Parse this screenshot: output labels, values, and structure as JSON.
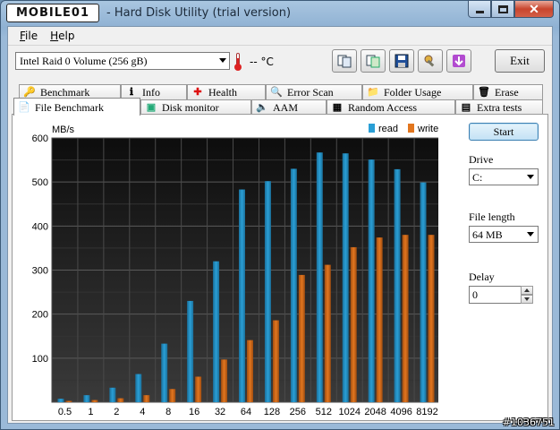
{
  "window": {
    "logo_text": "MOBILE01",
    "title": "- Hard Disk Utility (trial version)"
  },
  "menu": [
    {
      "label": "File",
      "underline": "F",
      "rest": "ile"
    },
    {
      "label": "Help",
      "underline": "H",
      "rest": "elp"
    }
  ],
  "toolbar": {
    "drive": "Intel   Raid 0 Volume (256 gB)",
    "temperature": "-- °C",
    "exit_label": "Exit"
  },
  "tabs_top": [
    "Benchmark",
    "Info",
    "Health",
    "Error Scan",
    "Folder Usage",
    "Erase"
  ],
  "tabs_bottom": [
    "File Benchmark",
    "Disk monitor",
    "AAM",
    "Random Access",
    "Extra tests"
  ],
  "active_tab": "File Benchmark",
  "controls": {
    "start_label": "Start",
    "drive_label": "Drive",
    "drive_value": "C:",
    "file_length_label": "File length",
    "file_length_value": "64 MB",
    "delay_label": "Delay",
    "delay_value": "0"
  },
  "colors": {
    "read": "#2a9fd6",
    "write": "#e2761f",
    "plot_bg": "#1a1a1a"
  },
  "chart_data": {
    "type": "bar",
    "ylabel": "MB/s",
    "xlabel": "",
    "ylim": [
      0,
      600
    ],
    "yticks": [
      100,
      200,
      300,
      400,
      500,
      600
    ],
    "categories": [
      "0.5",
      "1",
      "2",
      "4",
      "8",
      "16",
      "32",
      "64",
      "128",
      "256",
      "512",
      "1024",
      "2048",
      "4096",
      "8192"
    ],
    "legend_position": "top-right",
    "grid": true,
    "series": [
      {
        "name": "read",
        "values": [
          8,
          16,
          33,
          64,
          133,
          230,
          320,
          483,
          502,
          530,
          567,
          565,
          551,
          529,
          499
        ]
      },
      {
        "name": "write",
        "values": [
          3,
          5,
          9,
          16,
          30,
          58,
          97,
          141,
          186,
          289,
          312,
          352,
          374,
          380,
          380
        ]
      }
    ]
  },
  "watermark": "#1036751"
}
